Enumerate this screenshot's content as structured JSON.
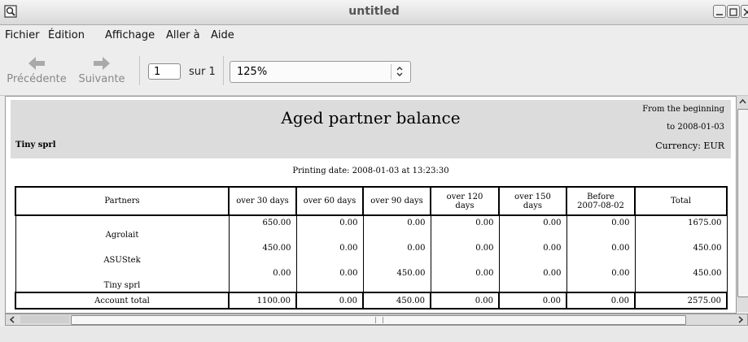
{
  "window": {
    "title": "untitled"
  },
  "menu": [
    "Fichier",
    "Édition",
    "Affichage",
    "Aller à",
    "Aide"
  ],
  "toolbar": {
    "prev_label": "Précédente",
    "next_label": "Suivante",
    "page_value": "1",
    "page_of": "sur 1",
    "zoom_value": "125%"
  },
  "report": {
    "title": "Aged partner balance",
    "company": "Tiny sprl",
    "from": "From the beginning",
    "to": "to 2008-01-03",
    "currency": "Currency: EUR",
    "printing_date": "Printing date: 2008-01-03 at 13:23:30",
    "columns": [
      "Partners",
      "over 30 days",
      "over 60 days",
      "over 90 days",
      "over 120 days",
      "over 150 days",
      "Before 2007-08-02",
      "Total"
    ],
    "rows": [
      {
        "partner": "Agrolait",
        "values": [
          "650.00",
          "0.00",
          "0.00",
          "0.00",
          "0.00",
          "0.00",
          "1675.00"
        ]
      },
      {
        "partner": "ASUStek",
        "values": [
          "450.00",
          "0.00",
          "0.00",
          "0.00",
          "0.00",
          "0.00",
          "450.00"
        ]
      },
      {
        "partner": "Tiny sprl",
        "values": [
          "0.00",
          "0.00",
          "450.00",
          "0.00",
          "0.00",
          "0.00",
          "450.00"
        ]
      }
    ],
    "total": {
      "label": "Account total",
      "values": [
        "1100.00",
        "0.00",
        "450.00",
        "0.00",
        "0.00",
        "0.00",
        "2575.00"
      ]
    }
  }
}
